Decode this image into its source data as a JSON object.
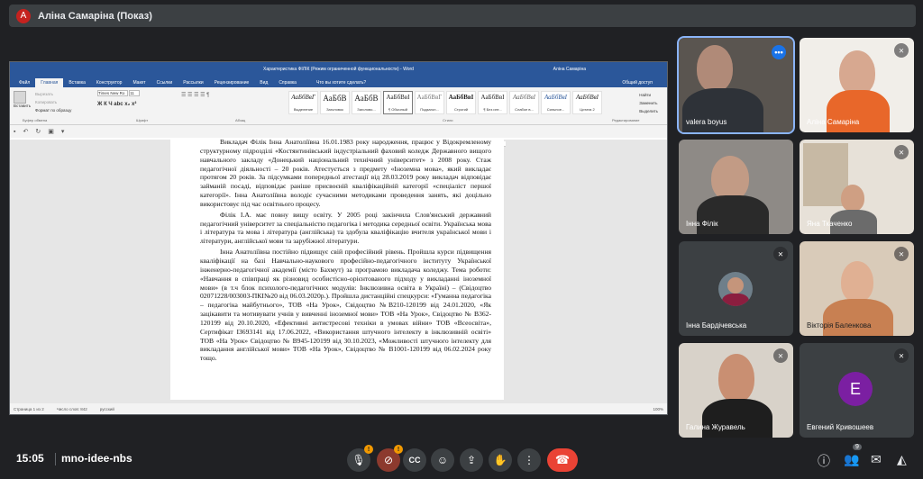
{
  "presenter": {
    "initial": "A",
    "title": "Аліна Самаріна (Показ)"
  },
  "word": {
    "title": "Характеристика ФІЛІК (Режим ограниченной функциональности) - Word",
    "user": "Аліна Самаріна",
    "tabs": [
      "Файл",
      "Главная",
      "Вставка",
      "Конструктор",
      "Макет",
      "Ссылки",
      "Рассылки",
      "Рецензирование",
      "Вид",
      "Справка",
      "Что вы хотите сделать?"
    ],
    "share": "Общий доступ",
    "clipboard": {
      "paste": "Вставить",
      "cut": "Вырезать",
      "copy": "Копировать",
      "format": "Формат по образцу",
      "label": "Буфер обмена"
    },
    "font": {
      "name": "Times New Ro",
      "size": "11",
      "label": "Шрифт"
    },
    "paragraph_label": "Абзац",
    "styles": [
      {
        "sample": "АаБбВвГ",
        "name": "Выделение"
      },
      {
        "sample": "АаБбВ",
        "name": "Заголовок"
      },
      {
        "sample": "АаБбВ",
        "name": "Заголово..."
      },
      {
        "sample": "АаБбВвІ",
        "name": "¶ Обычный"
      },
      {
        "sample": "АаБбВвГ",
        "name": "Подзагол..."
      },
      {
        "sample": "АаБбВвІ",
        "name": "Строгий"
      },
      {
        "sample": "АаБбВвІ",
        "name": "¶ Без инт..."
      },
      {
        "sample": "АаБбВвІ",
        "name": "Слабое в..."
      },
      {
        "sample": "АаБбВвІ",
        "name": "Сильное..."
      },
      {
        "sample": "АаБбВвІ",
        "name": "Цитата 2"
      }
    ],
    "styles_label": "Стили",
    "editing": {
      "find": "Найти",
      "replace": "Заменить",
      "select": "Выделить",
      "label": "Редактирование"
    },
    "paragraphs": [
      "Викладач Філік Інна Анатоліївна 16.01.1983 року народження, працює у Відокремленому структурному підрозділі «Костянтинівський індустріальний фаховий коледж Державного вищого навчального закладу «Донецький національний технічний університет» з 2008 року. Стаж педагогічної діяльності – 20 років. Атестується з предмету «Іноземна мова», який викладає протягом 20 років. За підсумками попередньої атестації від 28.03.2019 року викладач відповідає займаній посаді, відповідає раніше присвоєній кваліфікаційній категорії «спеціаліст першої категорії». Інна Анатоліївна володіє сучасними методиками проведення занять, які доцільно використовує під час освітнього процесу.",
      "Філік І.А. має повну вищу освіту. У 2005 році закінчила Слов'янський державний педагогічний університет за спеціальністю педагогіка і методика середньої освіти. Українська мова і література та мова і література (англійська) та здобула кваліфікацію вчителя української мови і літератури, англійської мови та зарубіжної літератури.",
      "Інна Анатоліївна постійно підвищує свій професійний рівень. Пройшла курси підвищення кваліфікації на базі Навчально-наукового професійно-педагогічного інституту Української інженерно-педагогічної академії (місто Бахмут) за програмою викладача коледжу. Тема роботи: «Навчання в співпраці як різновид особистісно-орієнтованого підходу у викладанні іноземної мови» (в т.ч блок психолого-педагогічних модулів: Інклюзивна освіта в Україні) – (Свідоцтво 02071228/003003-ПКІ№20 від 06.03.2020р.). Пройшла дистанційні спецкурси: «Гуманна педагогіка – педагогіка майбутнього», ТОВ «На Урок», Свідоцтво №В210-120199 від 24.01.2020, «Як зацікавити та мотивувати учнів у вивченні іноземної мови» ТОВ «На Урок», Свідоцтво № В362-120199 від 20.10.2020, «Ефективні антистресові техніки в умовах війни» ТОВ «Всеосвіта», Сертифікат ІЗ693141 від 17.06.2022, «Використання штучного інтелекту в інклюзивній освіті» ТОВ «На Урок» Свідоцтво № В945-120199 від 30.10.2023, «Можливості штучного інтелекту для викладання англійської мови» ТОВ «На Урок», Свідоцтво № В1001-120199 від 06.02.2024 року тощо."
    ],
    "status": {
      "page": "Страница 1 из 2",
      "words": "Число слов: 842",
      "lang": "русский",
      "zoom": "100%"
    }
  },
  "participants": [
    {
      "name": "valera boyus"
    },
    {
      "name": "Аліна Самаріна"
    },
    {
      "name": "Інна Філік"
    },
    {
      "name": "Яна Ткаченко"
    },
    {
      "name": "Інна Бардічевська"
    },
    {
      "name": "Вікторія Баленкова"
    },
    {
      "name": "Галина Журавель"
    },
    {
      "name": "Евгений Кривошеев",
      "initial": "E"
    }
  ],
  "bottom": {
    "time": "15:05",
    "code": "mno-idee-nbs",
    "people_count": "9",
    "mic_badge": "!",
    "cam_badge": "!"
  },
  "colors": {
    "bg": "#202124",
    "hangup": "#ea4335",
    "word_blue": "#2b579a",
    "active_outline": "#8ab4f8"
  }
}
